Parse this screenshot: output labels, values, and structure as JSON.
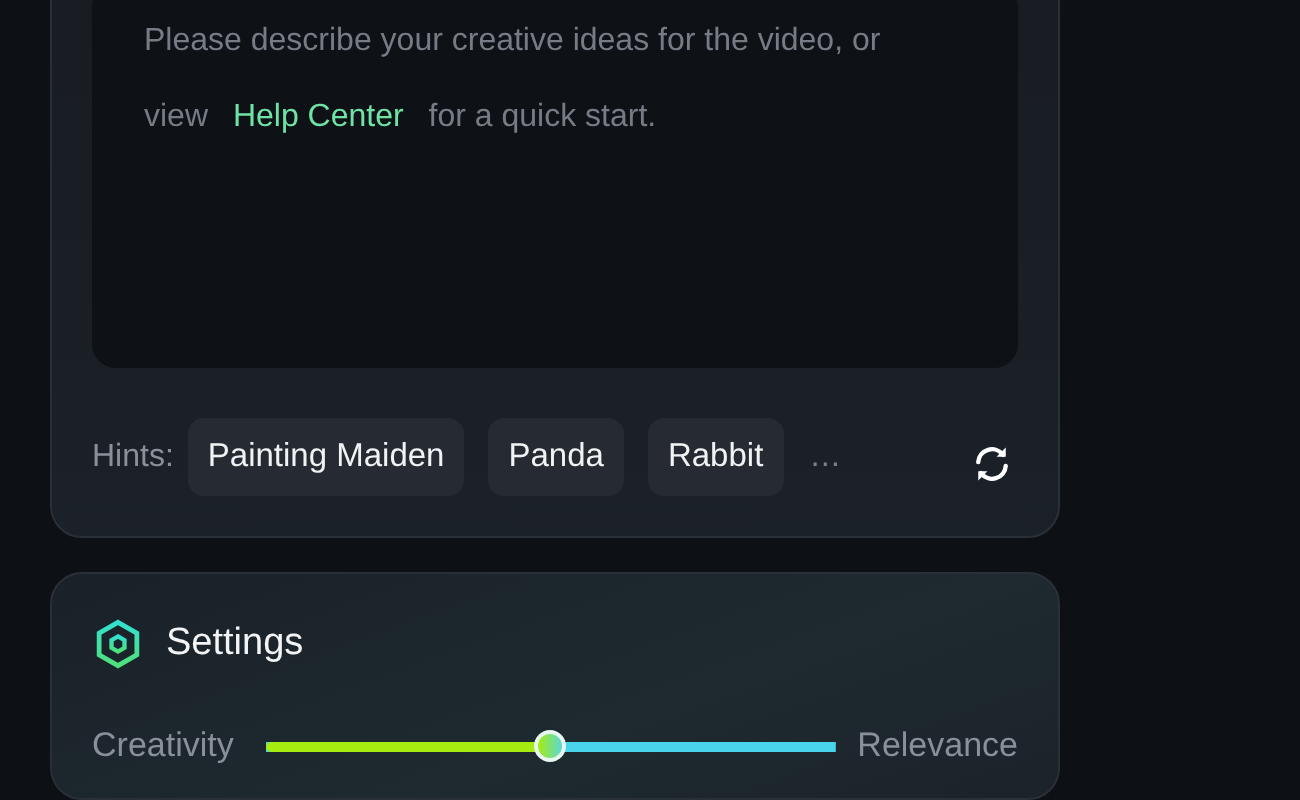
{
  "prompt": {
    "text_before": "Please describe your creative ideas for the video, or view",
    "link": "Help Center",
    "text_after": "for a quick start."
  },
  "hints": {
    "label": "Hints:",
    "chips": [
      "Painting Maiden",
      "Panda",
      "Rabbit"
    ],
    "more": "…"
  },
  "settings": {
    "title": "Settings",
    "slider": {
      "left_label": "Creativity",
      "right_label": "Relevance",
      "level": 0.5
    }
  }
}
